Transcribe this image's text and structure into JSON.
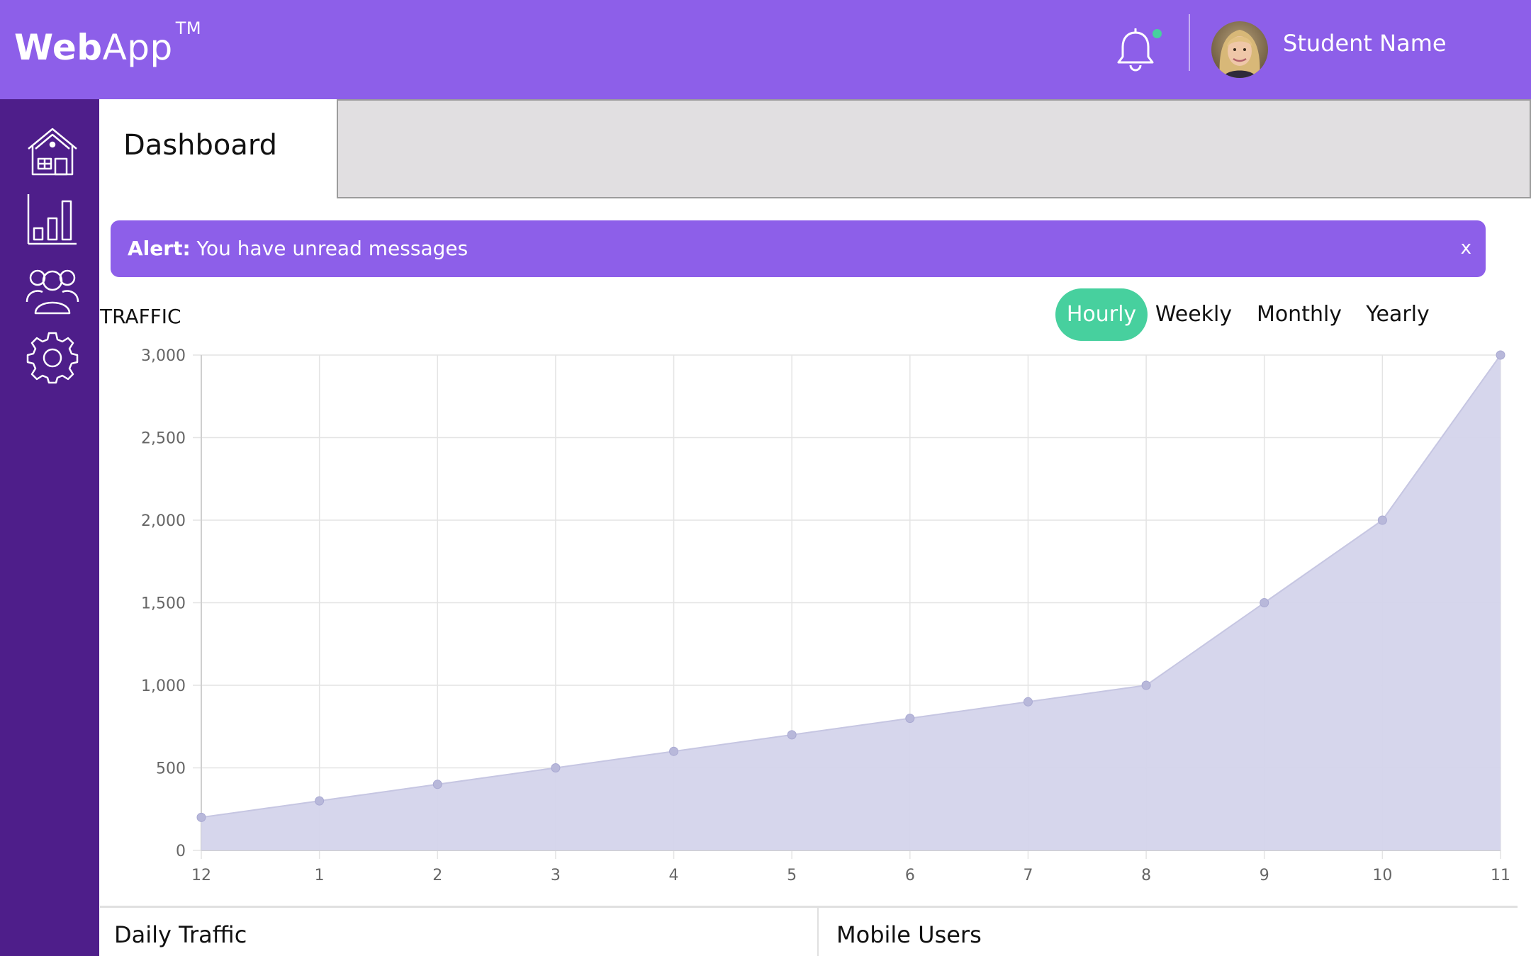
{
  "header": {
    "logo_bold": "Web",
    "logo_light": "App",
    "logo_tm": "TM",
    "user_name": "Student Name",
    "notification_dot_color": "#47d09e"
  },
  "sidebar": {
    "items": [
      {
        "icon": "home-icon"
      },
      {
        "icon": "bar-chart-icon"
      },
      {
        "icon": "users-icon"
      },
      {
        "icon": "settings-icon"
      }
    ]
  },
  "page": {
    "title": "Dashboard"
  },
  "alert": {
    "label": "Alert:",
    "message": " You have unread messages",
    "close": "x"
  },
  "traffic": {
    "title": "TRAFFIC",
    "tabs": [
      "Hourly",
      "Weekly",
      "Monthly",
      "Yearly"
    ],
    "active_tab": "Hourly"
  },
  "chart_data": {
    "type": "area",
    "x": [
      "12",
      "1",
      "2",
      "3",
      "4",
      "5",
      "6",
      "7",
      "8",
      "9",
      "10",
      "11"
    ],
    "values": [
      200,
      300,
      400,
      500,
      600,
      700,
      800,
      900,
      1000,
      1500,
      2000,
      3000
    ],
    "yticks": [
      "0",
      "500",
      "1,000",
      "1,500",
      "2,000",
      "2,500",
      "3,000"
    ],
    "ylim": [
      0,
      3000
    ],
    "grid": true,
    "fill_color": "#d4d4eb",
    "line_color": "#c6c6e2",
    "point_color": "#b8b8da"
  },
  "bottom": {
    "daily_title": "Daily Traffic",
    "mobile_title": "Mobile Users"
  },
  "colors": {
    "header": "#8d5fe9",
    "sidebar": "#4e1e8a",
    "accent": "#47d09e"
  }
}
